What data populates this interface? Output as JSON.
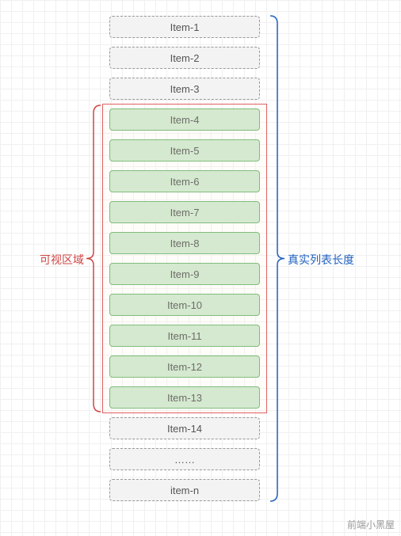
{
  "items": [
    {
      "label": "Item-1",
      "state": "virtual"
    },
    {
      "label": "Item-2",
      "state": "virtual"
    },
    {
      "label": "Item-3",
      "state": "virtual"
    },
    {
      "label": "Item-4",
      "state": "visible"
    },
    {
      "label": "Item-5",
      "state": "visible"
    },
    {
      "label": "Item-6",
      "state": "visible"
    },
    {
      "label": "Item-7",
      "state": "visible"
    },
    {
      "label": "Item-8",
      "state": "visible"
    },
    {
      "label": "Item-9",
      "state": "visible"
    },
    {
      "label": "Item-10",
      "state": "visible"
    },
    {
      "label": "Item-11",
      "state": "visible"
    },
    {
      "label": "Item-12",
      "state": "visible"
    },
    {
      "label": "Item-13",
      "state": "visible"
    },
    {
      "label": "Item-14",
      "state": "virtual"
    },
    {
      "label": "……",
      "state": "virtual"
    },
    {
      "label": "item-n",
      "state": "virtual"
    }
  ],
  "viewport": {
    "startIndex": 3,
    "endIndex": 12
  },
  "labels": {
    "visibleArea": "可视区域",
    "fullListLength": "真实列表长度"
  },
  "colors": {
    "virtualBorder": "#999999",
    "virtualFill": "#f3f3f3",
    "visibleBorder": "#6cb36c",
    "visibleFill": "#cde8cd",
    "viewportBorder": "#e06060",
    "bracketLeft": "#d04545",
    "bracketRight": "#2060c0"
  },
  "watermark": "前端小黑屋"
}
